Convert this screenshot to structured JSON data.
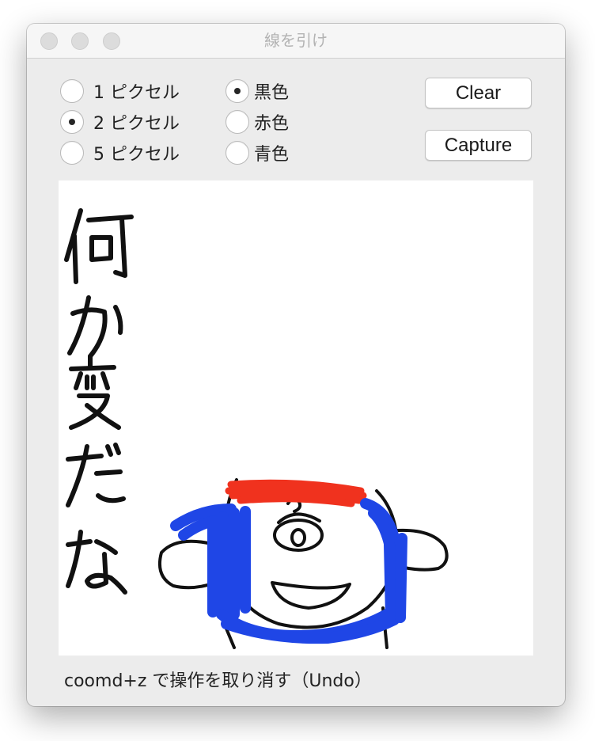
{
  "window": {
    "title": "線を引け"
  },
  "line_width": {
    "options": [
      {
        "label": "1 ピクセル",
        "checked": false
      },
      {
        "label": "2 ピクセル",
        "checked": true
      },
      {
        "label": "5 ピクセル",
        "checked": false
      }
    ]
  },
  "line_color": {
    "options": [
      {
        "label": "黒色",
        "checked": true
      },
      {
        "label": "赤色",
        "checked": false
      },
      {
        "label": "青色",
        "checked": false
      }
    ]
  },
  "buttons": {
    "clear": "Clear",
    "capture": "Capture"
  },
  "drawing": {
    "handwritten_text": "何か変だな",
    "stroke_colors": {
      "black": "#111111",
      "red": "#f0321e",
      "blue": "#1f46e6"
    }
  },
  "footer": {
    "hint": "coomd+z で操作を取り消す（Undo）"
  }
}
